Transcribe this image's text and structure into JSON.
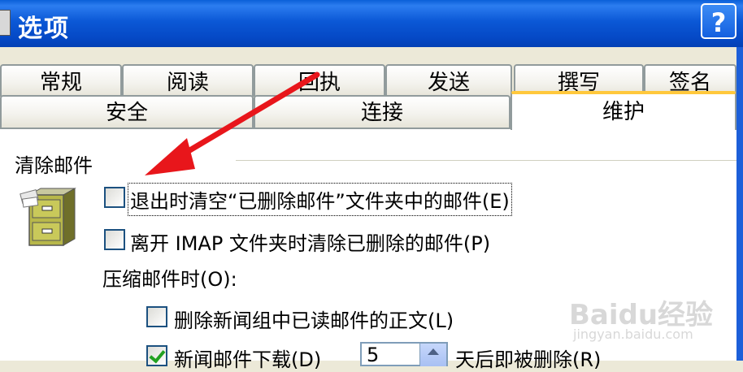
{
  "window": {
    "title": "选项",
    "help_label": "?"
  },
  "tabs_row1": [
    {
      "label": "常规"
    },
    {
      "label": "阅读"
    },
    {
      "label": "回执"
    },
    {
      "label": "发送"
    },
    {
      "label": "撰写"
    },
    {
      "label": "签名"
    }
  ],
  "tabs_row2": [
    {
      "label": "安全"
    },
    {
      "label": "连接"
    },
    {
      "label": "维护",
      "selected": true
    }
  ],
  "group": {
    "title": "清除邮件"
  },
  "options": {
    "empty_deleted": {
      "label": "退出时清空“已删除邮件”文件夹中的邮件(E)",
      "checked": false
    },
    "purge_imap": {
      "label": "离开 IMAP 文件夹时清除已删除的邮件(P)",
      "checked": false
    },
    "compact_label": "压缩邮件时(O):",
    "delete_read_news": {
      "label": "删除新闻组中已读邮件的正文(L)",
      "checked": false
    },
    "news_download": {
      "label": "新闻邮件下载(D)",
      "checked": true,
      "days_value": "5",
      "suffix": "天后即被删除(R)"
    }
  },
  "watermark": {
    "brand": "Baidu经验",
    "url": "jingyan.baidu.com"
  },
  "colors": {
    "titlebar": "#0549C6",
    "active_tab_accent": "#FFC83C",
    "annotation_arrow": "#E8161B"
  }
}
